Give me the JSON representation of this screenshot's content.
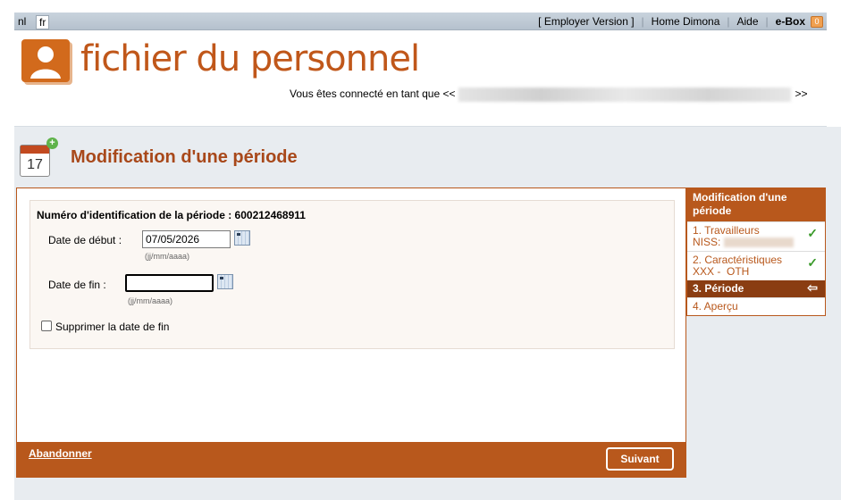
{
  "topbar": {
    "lang_nl": "nl",
    "lang_fr": "fr",
    "links": [
      "[ Employer Version ]",
      "Home Dimona",
      "Aide",
      "e-Box"
    ],
    "ebox_badge": "0"
  },
  "header": {
    "app_title": "fichier du personnel",
    "connected_prefix": "Vous êtes connecté en tant que <<",
    "connected_suffix": ">>"
  },
  "page": {
    "title": "Modification d'une période",
    "calendar_day": "17"
  },
  "form": {
    "periode_id": "Numéro d'identification de la période : 600212468911",
    "start_label": "Date de début :",
    "start_value": "07/05/2026",
    "start_hint": "(jj/mm/aaaa)",
    "end_label": "Date de fin :",
    "end_value": "",
    "end_hint": "(jj/mm/aaaa)",
    "delete_end_label": "Supprimer la date de fin",
    "delete_end_checked": false,
    "abandon_label": "Abandonner",
    "next_label": "Suivant"
  },
  "steps": {
    "title": "Modification d'une période",
    "items": [
      {
        "label": "1. Travailleurs",
        "sub": "NISS:",
        "state": "done"
      },
      {
        "label": "2. Caractéristiques",
        "sub": "XXX -  OTH",
        "state": "done"
      },
      {
        "label": "3. Période",
        "sub": "",
        "state": "current"
      },
      {
        "label": "4. Aperçu",
        "sub": "",
        "state": "todo"
      }
    ]
  },
  "colors": {
    "accent": "#b8581c",
    "current_step": "#8a3d12",
    "check": "#3a9a2a"
  }
}
